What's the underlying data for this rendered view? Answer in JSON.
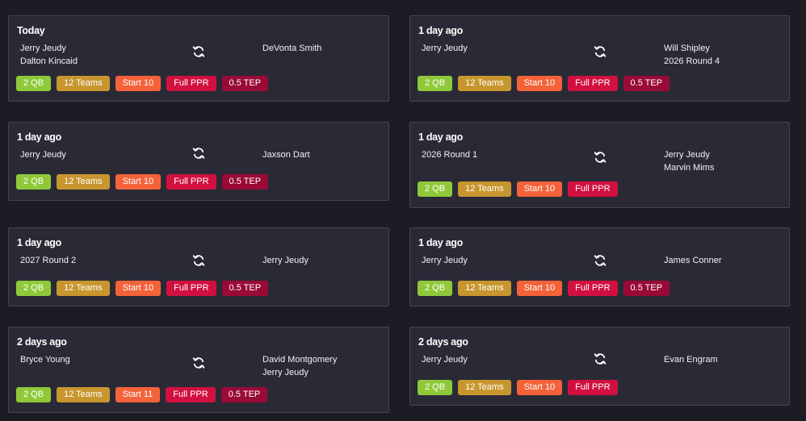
{
  "colors": {
    "background": "#1c1c24",
    "card": "#2a2a36",
    "qb_tag": "#8fc93a",
    "teams_tag": "#c8962e",
    "start_tag": "#f4623a",
    "ppr_tag": "#d1103f",
    "tep_tag": "#990a37"
  },
  "trades": [
    {
      "time": "Today",
      "left": [
        "Jerry Jeudy",
        "Dalton Kincaid"
      ],
      "right": [
        "DeVonta Smith"
      ],
      "icon": "swap-icon",
      "tags": [
        "2 QB",
        "12 Teams",
        "Start 10",
        "Full PPR",
        "0.5 TEP"
      ]
    },
    {
      "time": "1 day ago",
      "left": [
        "Jerry Jeudy"
      ],
      "right": [
        "Will Shipley",
        "2026 Round 4"
      ],
      "icon": "swap-icon",
      "tags": [
        "2 QB",
        "12 Teams",
        "Start 10",
        "Full PPR",
        "0.5 TEP"
      ]
    },
    {
      "time": "1 day ago",
      "left": [
        "Jerry Jeudy"
      ],
      "right": [
        "Jaxson Dart"
      ],
      "icon": "swap-icon",
      "tags": [
        "2 QB",
        "12 Teams",
        "Start 10",
        "Full PPR",
        "0.5 TEP"
      ]
    },
    {
      "time": "1 day ago",
      "left": [
        "2026 Round 1"
      ],
      "right": [
        "Jerry Jeudy",
        "Marvin Mims"
      ],
      "icon": "swap-icon",
      "tags": [
        "2 QB",
        "12 Teams",
        "Start 10",
        "Full PPR"
      ]
    },
    {
      "time": "1 day ago",
      "left": [
        "2027 Round 2"
      ],
      "right": [
        "Jerry Jeudy"
      ],
      "icon": "swap-icon",
      "tags": [
        "2 QB",
        "12 Teams",
        "Start 10",
        "Full PPR",
        "0.5 TEP"
      ]
    },
    {
      "time": "1 day ago",
      "left": [
        "Jerry Jeudy"
      ],
      "right": [
        "James Conner"
      ],
      "icon": "swap-icon",
      "tags": [
        "2 QB",
        "12 Teams",
        "Start 10",
        "Full PPR",
        "0.5 TEP"
      ]
    },
    {
      "time": "2 days ago",
      "left": [
        "Bryce Young"
      ],
      "right": [
        "David Montgomery",
        "Jerry Jeudy"
      ],
      "icon": "swap-icon",
      "tags": [
        "2 QB",
        "12 Teams",
        "Start 11",
        "Full PPR",
        "0.5 TEP"
      ]
    },
    {
      "time": "2 days ago",
      "left": [
        "Jerry Jeudy"
      ],
      "right": [
        "Evan Engram"
      ],
      "icon": "swap-icon",
      "tags": [
        "2 QB",
        "12 Teams",
        "Start 10",
        "Full PPR"
      ]
    }
  ]
}
